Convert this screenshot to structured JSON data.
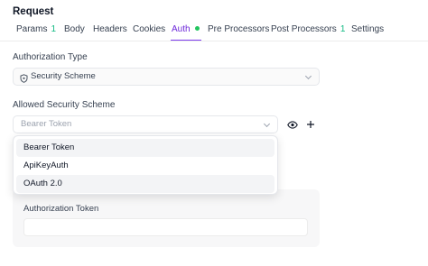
{
  "header": {
    "title": "Request"
  },
  "tabs": [
    {
      "label": "Params",
      "count": "1"
    },
    {
      "label": "Body"
    },
    {
      "label": "Headers"
    },
    {
      "label": "Cookies"
    },
    {
      "label": "Auth",
      "active": true,
      "indicator": "green-dot"
    },
    {
      "label": "Pre Processors"
    },
    {
      "label": "Post Processors",
      "count": "1"
    },
    {
      "label": "Settings"
    }
  ],
  "auth": {
    "authorization_type_label": "Authorization Type",
    "authorization_type_value": "Security Scheme",
    "authorization_type_icon": "shield-icon",
    "allowed_scheme_label": "Allowed Security Scheme",
    "allowed_scheme_placeholder": "Bearer Token",
    "options": [
      "Bearer Token",
      "ApiKeyAuth",
      "OAuth 2.0"
    ],
    "token_label": "Authorization Token",
    "token_value": ""
  },
  "colors": {
    "accent": "#7c3aed",
    "count_green": "#10b981",
    "dot_green": "#22c55e"
  }
}
